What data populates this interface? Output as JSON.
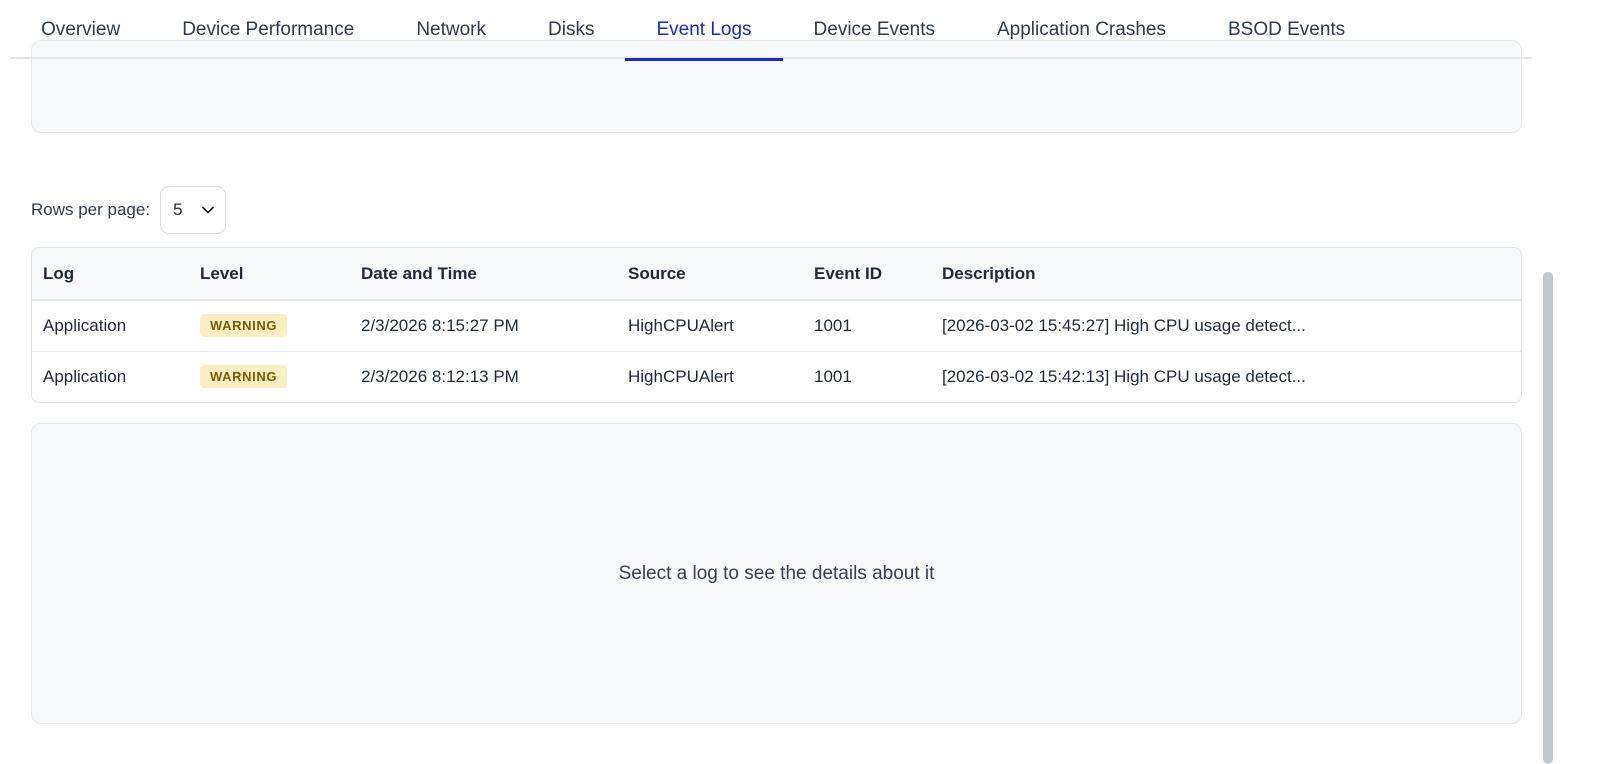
{
  "tabs": [
    {
      "label": "Overview"
    },
    {
      "label": "Device Performance"
    },
    {
      "label": "Network"
    },
    {
      "label": "Disks"
    },
    {
      "label": "Event Logs"
    },
    {
      "label": "Device Events"
    },
    {
      "label": "Application Crashes"
    },
    {
      "label": "BSOD Events"
    }
  ],
  "active_tab": "Event Logs",
  "rows_per_page": {
    "label": "Rows per page:",
    "value": "5"
  },
  "table": {
    "columns": [
      "Log",
      "Level",
      "Date and Time",
      "Source",
      "Event ID",
      "Description"
    ],
    "rows": [
      {
        "log": "Application",
        "level": "WARNING",
        "datetime": "2/3/2026 8:15:27 PM",
        "source": "HighCPUAlert",
        "event_id": "1001",
        "description": "[2026-03-02 15:45:27] High CPU usage detect..."
      },
      {
        "log": "Application",
        "level": "WARNING",
        "datetime": "2/3/2026 8:12:13 PM",
        "source": "HighCPUAlert",
        "event_id": "1001",
        "description": "[2026-03-02 15:42:13] High CPU usage detect..."
      }
    ]
  },
  "details": {
    "empty_message": "Select a log to see the details about it"
  },
  "colors": {
    "accent": "#1d2bb8",
    "warning_bg": "#fdeec2",
    "warning_text": "#7a5a06",
    "panel_bg": "#f7f8fa"
  }
}
